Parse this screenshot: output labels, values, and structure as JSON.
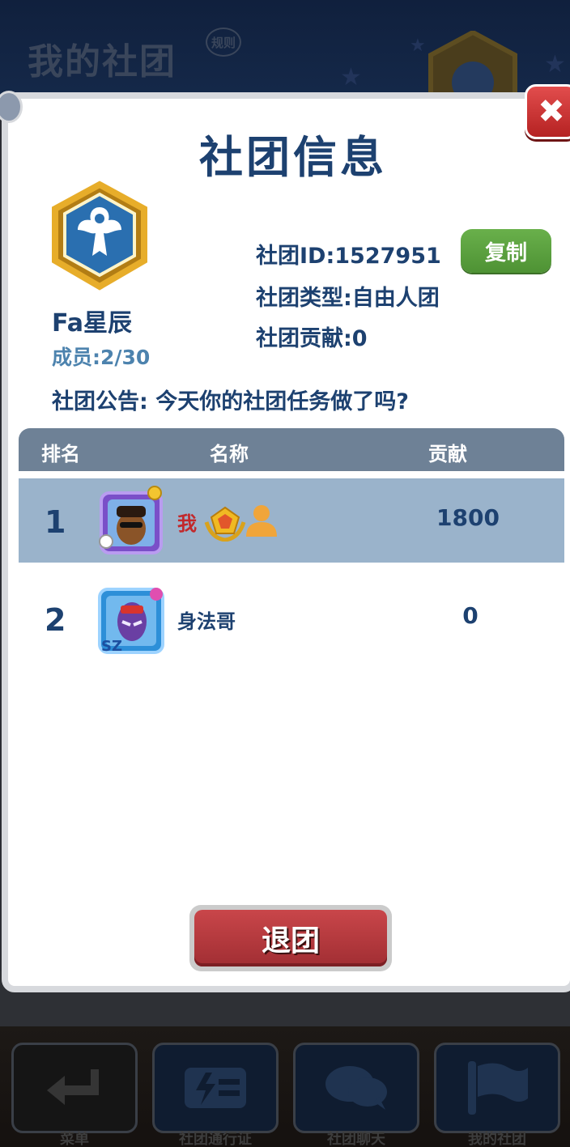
{
  "background": {
    "title": "我的社团",
    "rules_label": "规则",
    "nav": [
      {
        "label": "菜单",
        "icon": "return-arrow-icon"
      },
      {
        "label": "社团通行证",
        "icon": "pass-ticket-icon"
      },
      {
        "label": "社团聊天",
        "icon": "chat-bubbles-icon"
      },
      {
        "label": "我的社团",
        "icon": "flag-icon"
      }
    ]
  },
  "dialog": {
    "title": "社团信息",
    "close_label": "✖",
    "club": {
      "badge_icon": "winged-emblem-badge-icon",
      "name": "Fa星辰",
      "members": "成员:2/30",
      "id_text": "社团ID:1527951",
      "type_text": "社团类型:自由人团",
      "contribution_text": "社团贡献:0",
      "copy_label": "复制"
    },
    "notice": "社团公告: 今天你的社团任务做了吗?",
    "table": {
      "headers": {
        "rank": "排名",
        "name": "名称",
        "contribution": "贡献"
      },
      "rows": [
        {
          "rank": "1",
          "name": "我",
          "contribution": "1800",
          "is_self": true
        },
        {
          "rank": "2",
          "name": "身法哥",
          "contribution": "0",
          "is_self": false
        }
      ]
    },
    "quit_label": "退团"
  },
  "colors": {
    "title_blue": "#1d4170",
    "self_red": "#c2282b",
    "copy_green": "#5ba23f",
    "quit_red": "#b83a3f",
    "header_gray": "#6e8196",
    "self_row": "#9ab3cb"
  }
}
